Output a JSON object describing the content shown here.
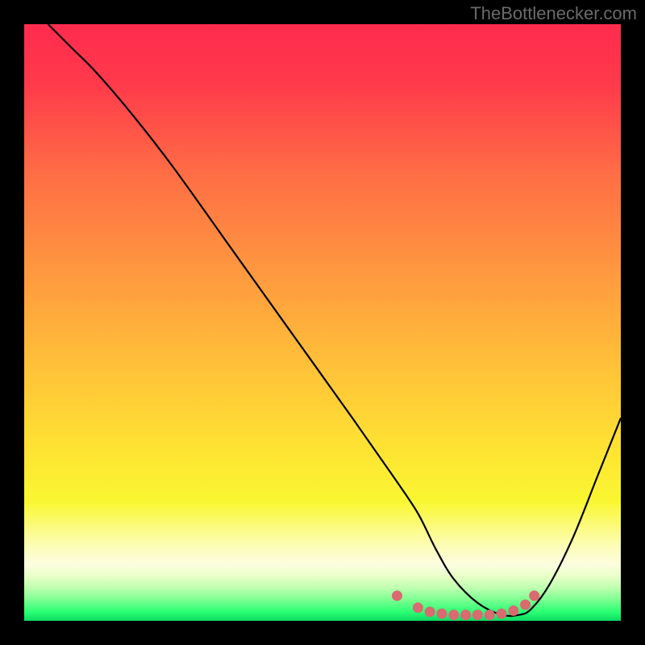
{
  "watermark": "TheBottlenecker.com",
  "chart_data": {
    "type": "line",
    "title": "",
    "xlabel": "",
    "ylabel": "",
    "xlim": [
      0,
      100
    ],
    "ylim": [
      0,
      100
    ],
    "series": [
      {
        "name": "curve",
        "x": [
          4,
          8,
          12,
          18,
          25,
          35,
          45,
          55,
          62,
          66,
          69,
          72,
          76,
          80,
          83,
          85,
          88,
          92,
          96,
          100
        ],
        "y": [
          100,
          96,
          92,
          85,
          76,
          62,
          48,
          34,
          24,
          18,
          12,
          7,
          3,
          1,
          1,
          2,
          6,
          14,
          24,
          34
        ]
      }
    ],
    "markers": {
      "name": "dots",
      "color": "#d86a70",
      "x": [
        62.5,
        66,
        68,
        70,
        72,
        74,
        76,
        78,
        80,
        82,
        84,
        85.5
      ],
      "y": [
        4.2,
        2.2,
        1.5,
        1.2,
        1.0,
        1.0,
        1.0,
        1.0,
        1.2,
        1.7,
        2.7,
        4.2
      ]
    },
    "gradient_stops": [
      {
        "offset": 0.0,
        "color": "#ff2b4e"
      },
      {
        "offset": 0.1,
        "color": "#ff3a4b"
      },
      {
        "offset": 0.25,
        "color": "#ff6d45"
      },
      {
        "offset": 0.4,
        "color": "#ff9440"
      },
      {
        "offset": 0.55,
        "color": "#ffbb3a"
      },
      {
        "offset": 0.7,
        "color": "#ffe033"
      },
      {
        "offset": 0.8,
        "color": "#f9f731"
      },
      {
        "offset": 0.87,
        "color": "#fdfdb0"
      },
      {
        "offset": 0.905,
        "color": "#fdfde0"
      },
      {
        "offset": 0.925,
        "color": "#e9ffc8"
      },
      {
        "offset": 0.945,
        "color": "#beffb0"
      },
      {
        "offset": 0.965,
        "color": "#7bff90"
      },
      {
        "offset": 0.985,
        "color": "#2bff74"
      },
      {
        "offset": 1.0,
        "color": "#0bdb62"
      }
    ]
  }
}
